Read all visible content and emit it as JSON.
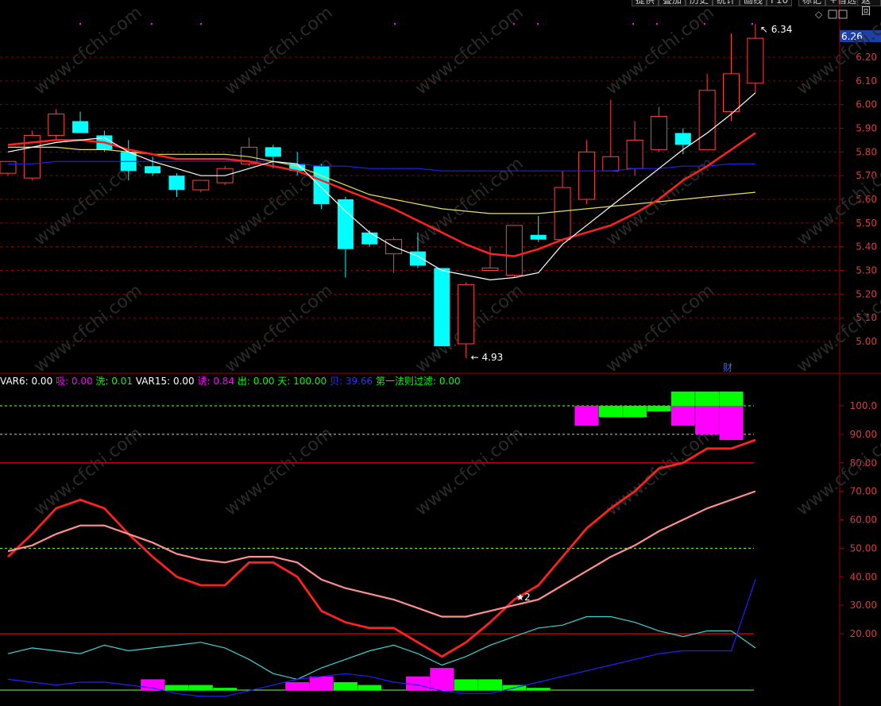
{
  "toolbar": {
    "buttons": [
      "提供",
      "叠加",
      "历史",
      "统计",
      "画线",
      "F10",
      "标记",
      "+自选",
      "返回"
    ]
  },
  "price_axis": {
    "current_price": "6.26",
    "ticks": [
      "6.20",
      "6.10",
      "6.00",
      "5.90",
      "5.80",
      "5.70",
      "5.60",
      "5.50",
      "5.40",
      "5.30",
      "5.20",
      "5.10",
      "5.00"
    ]
  },
  "indicator_axis": {
    "ticks": [
      "100.0",
      "90.00",
      "80.00",
      "70.00",
      "60.00",
      "50.00",
      "40.00",
      "30.00",
      "20.00"
    ]
  },
  "annotations": {
    "high": "6.34",
    "low": "4.93",
    "fin_marker": "财",
    "star_marker": "★2"
  },
  "indicator_labels": [
    {
      "text": "VAR6: 0.00",
      "color": "#ffffff"
    },
    {
      "text": "吸: 0.00",
      "color": "#ff00ff"
    },
    {
      "text": "洗: 0.01",
      "color": "#00ff00"
    },
    {
      "text": "VAR15: 0.00",
      "color": "#ffffff"
    },
    {
      "text": "诱: 0.84",
      "color": "#ff00ff"
    },
    {
      "text": "出: 0.00",
      "color": "#00ff00"
    },
    {
      "text": "天: 100.00",
      "color": "#00ff00"
    },
    {
      "text": "贝: 39.66",
      "color": "#3030ff"
    },
    {
      "text": "第一法则过滤: 0.00",
      "color": "#00ff00"
    }
  ],
  "watermark": "www.cfchi.com",
  "colors": {
    "up": "#ff4040",
    "down": "#00ffff",
    "ma5": "#ffffff",
    "ma10": "#ff2020",
    "ma20": "#e8e060",
    "ma60": "#2020ff",
    "red_line": "#ff2020",
    "pink_line": "#ff9090",
    "cyan_line": "#40d0d0",
    "blue_line": "#2020ff",
    "magenta": "#ff00ff",
    "green": "#00ff00",
    "grid": "#8b0000"
  },
  "chart_data": [
    {
      "type": "candlestick",
      "ylim": [
        4.9,
        6.4
      ],
      "candles": [
        {
          "o": 5.71,
          "h": 5.76,
          "l": 5.7,
          "c": 5.76
        },
        {
          "o": 5.69,
          "h": 5.89,
          "l": 5.68,
          "c": 5.87
        },
        {
          "o": 5.87,
          "h": 5.98,
          "l": 5.85,
          "c": 5.96
        },
        {
          "o": 5.93,
          "h": 5.97,
          "l": 5.88,
          "c": 5.88
        },
        {
          "o": 5.87,
          "h": 5.89,
          "l": 5.8,
          "c": 5.81
        },
        {
          "o": 5.8,
          "h": 5.85,
          "l": 5.68,
          "c": 5.72
        },
        {
          "o": 5.74,
          "h": 5.78,
          "l": 5.7,
          "c": 5.71
        },
        {
          "o": 5.7,
          "h": 5.71,
          "l": 5.61,
          "c": 5.64
        },
        {
          "o": 5.64,
          "h": 5.68,
          "l": 5.63,
          "c": 5.68
        },
        {
          "o": 5.67,
          "h": 5.74,
          "l": 5.66,
          "c": 5.73
        },
        {
          "o": 5.75,
          "h": 5.86,
          "l": 5.74,
          "c": 5.82
        },
        {
          "o": 5.82,
          "h": 5.83,
          "l": 5.73,
          "c": 5.78
        },
        {
          "o": 5.75,
          "h": 5.8,
          "l": 5.7,
          "c": 5.72
        },
        {
          "o": 5.74,
          "h": 5.75,
          "l": 5.56,
          "c": 5.58
        },
        {
          "o": 5.6,
          "h": 5.61,
          "l": 5.27,
          "c": 5.39
        },
        {
          "o": 5.46,
          "h": 5.47,
          "l": 5.4,
          "c": 5.41
        },
        {
          "o": 5.37,
          "h": 5.44,
          "l": 5.29,
          "c": 5.43
        },
        {
          "o": 5.38,
          "h": 5.46,
          "l": 5.31,
          "c": 5.32
        },
        {
          "o": 5.31,
          "h": 5.31,
          "l": 4.98,
          "c": 4.98
        },
        {
          "o": 4.99,
          "h": 5.25,
          "l": 4.93,
          "c": 5.24
        },
        {
          "o": 5.3,
          "h": 5.4,
          "l": 5.3,
          "c": 5.31
        },
        {
          "o": 5.28,
          "h": 5.49,
          "l": 5.27,
          "c": 5.49
        },
        {
          "o": 5.45,
          "h": 5.53,
          "l": 5.42,
          "c": 5.43
        },
        {
          "o": 5.43,
          "h": 5.72,
          "l": 5.42,
          "c": 5.65
        },
        {
          "o": 5.6,
          "h": 5.85,
          "l": 5.58,
          "c": 5.8
        },
        {
          "o": 5.72,
          "h": 6.02,
          "l": 5.72,
          "c": 5.78
        },
        {
          "o": 5.73,
          "h": 5.93,
          "l": 5.7,
          "c": 5.85
        },
        {
          "o": 5.81,
          "h": 5.99,
          "l": 5.8,
          "c": 5.95
        },
        {
          "o": 5.88,
          "h": 5.9,
          "l": 5.79,
          "c": 5.83
        },
        {
          "o": 5.81,
          "h": 6.13,
          "l": 5.81,
          "c": 6.06
        },
        {
          "o": 5.97,
          "h": 6.3,
          "l": 5.93,
          "c": 6.13
        },
        {
          "o": 6.09,
          "h": 6.34,
          "l": 6.05,
          "c": 6.28
        }
      ],
      "ma5": [
        5.8,
        5.82,
        5.84,
        5.85,
        5.86,
        5.8,
        5.76,
        5.73,
        5.7,
        5.7,
        5.73,
        5.76,
        5.75,
        5.65,
        5.55,
        5.46,
        5.4,
        5.36,
        5.3,
        5.28,
        5.26,
        5.27,
        5.29,
        5.41,
        5.49,
        5.57,
        5.65,
        5.73,
        5.81,
        5.88,
        5.96,
        6.05
      ],
      "ma10": [
        5.83,
        5.84,
        5.85,
        5.85,
        5.84,
        5.81,
        5.79,
        5.77,
        5.77,
        5.77,
        5.76,
        5.74,
        5.72,
        5.68,
        5.64,
        5.6,
        5.56,
        5.51,
        5.46,
        5.41,
        5.37,
        5.36,
        5.39,
        5.43,
        5.46,
        5.49,
        5.54,
        5.6,
        5.68,
        5.74,
        5.81,
        5.88
      ],
      "ma20": [
        5.82,
        5.82,
        5.82,
        5.81,
        5.81,
        5.8,
        5.79,
        5.79,
        5.79,
        5.79,
        5.78,
        5.76,
        5.74,
        5.7,
        5.66,
        5.62,
        5.6,
        5.58,
        5.56,
        5.55,
        5.54,
        5.54,
        5.54,
        5.55,
        5.56,
        5.57,
        5.58,
        5.59,
        5.6,
        5.61,
        5.62,
        5.63
      ],
      "ma60": [
        5.75,
        5.75,
        5.76,
        5.76,
        5.76,
        5.76,
        5.76,
        5.76,
        5.76,
        5.76,
        5.76,
        5.76,
        5.75,
        5.74,
        5.74,
        5.73,
        5.73,
        5.73,
        5.72,
        5.72,
        5.72,
        5.72,
        5.72,
        5.72,
        5.72,
        5.72,
        5.73,
        5.73,
        5.74,
        5.74,
        5.75,
        5.75
      ]
    },
    {
      "type": "line",
      "ylim": [
        0,
        105
      ],
      "reference_lines": [
        100,
        90,
        80,
        50,
        20
      ],
      "series": [
        {
          "key": "red",
          "values": [
            47,
            55,
            64,
            67,
            64,
            55,
            47,
            40,
            37,
            37,
            45,
            45,
            40,
            28,
            24,
            22,
            22,
            17,
            12,
            17,
            24,
            32,
            37,
            47,
            57,
            64,
            70,
            78,
            80,
            85,
            85,
            88
          ]
        },
        {
          "key": "pink",
          "values": [
            49,
            51,
            55,
            58,
            58,
            55,
            52,
            48,
            46,
            45,
            47,
            47,
            45,
            39,
            36,
            34,
            32,
            29,
            26,
            26,
            28,
            30,
            32,
            37,
            42,
            47,
            51,
            56,
            60,
            64,
            67,
            70
          ]
        },
        {
          "key": "cyan",
          "values": [
            13,
            15,
            14,
            13,
            16,
            14,
            15,
            16,
            17,
            15,
            11,
            6,
            4,
            8,
            11,
            14,
            16,
            13,
            9,
            12,
            16,
            19,
            22,
            23,
            26,
            26,
            24,
            21,
            19,
            21,
            21,
            15
          ]
        },
        {
          "key": "blue",
          "values": [
            4,
            3,
            2,
            3,
            3,
            2,
            1,
            -1,
            -2,
            -2,
            0,
            2,
            4,
            5,
            6,
            5,
            3,
            2,
            0,
            -1,
            -1,
            1,
            3,
            5,
            7,
            9,
            11,
            13,
            14,
            14,
            14,
            39
          ]
        }
      ],
      "bars_magenta": [
        {
          "i": 6,
          "from": 0,
          "to": 4
        },
        {
          "i": 12,
          "from": 0,
          "to": 3
        },
        {
          "i": 13,
          "from": 0,
          "to": 5
        },
        {
          "i": 17,
          "from": 0,
          "to": 5
        },
        {
          "i": 18,
          "from": 0,
          "to": 8
        },
        {
          "i": 24,
          "from": 93,
          "to": 100
        },
        {
          "i": 28,
          "from": 93,
          "to": 100
        },
        {
          "i": 29,
          "from": 90,
          "to": 100
        },
        {
          "i": 30,
          "from": 88,
          "to": 100
        }
      ],
      "bars_green": [
        {
          "i": 7,
          "from": 0,
          "to": 2
        },
        {
          "i": 8,
          "from": 0,
          "to": 2
        },
        {
          "i": 9,
          "from": 0,
          "to": 1
        },
        {
          "i": 14,
          "from": 0,
          "to": 3
        },
        {
          "i": 15,
          "from": 0,
          "to": 2
        },
        {
          "i": 19,
          "from": 0,
          "to": 4
        },
        {
          "i": 20,
          "from": 0,
          "to": 4
        },
        {
          "i": 21,
          "from": 0,
          "to": 2
        },
        {
          "i": 22,
          "from": 0,
          "to": 1
        },
        {
          "i": 25,
          "from": 96,
          "to": 100
        },
        {
          "i": 26,
          "from": 96,
          "to": 100
        },
        {
          "i": 27,
          "from": 98,
          "to": 100
        },
        {
          "i": 28,
          "from": 100,
          "to": 105
        },
        {
          "i": 29,
          "from": 100,
          "to": 105
        },
        {
          "i": 30,
          "from": 100,
          "to": 105
        }
      ]
    }
  ]
}
